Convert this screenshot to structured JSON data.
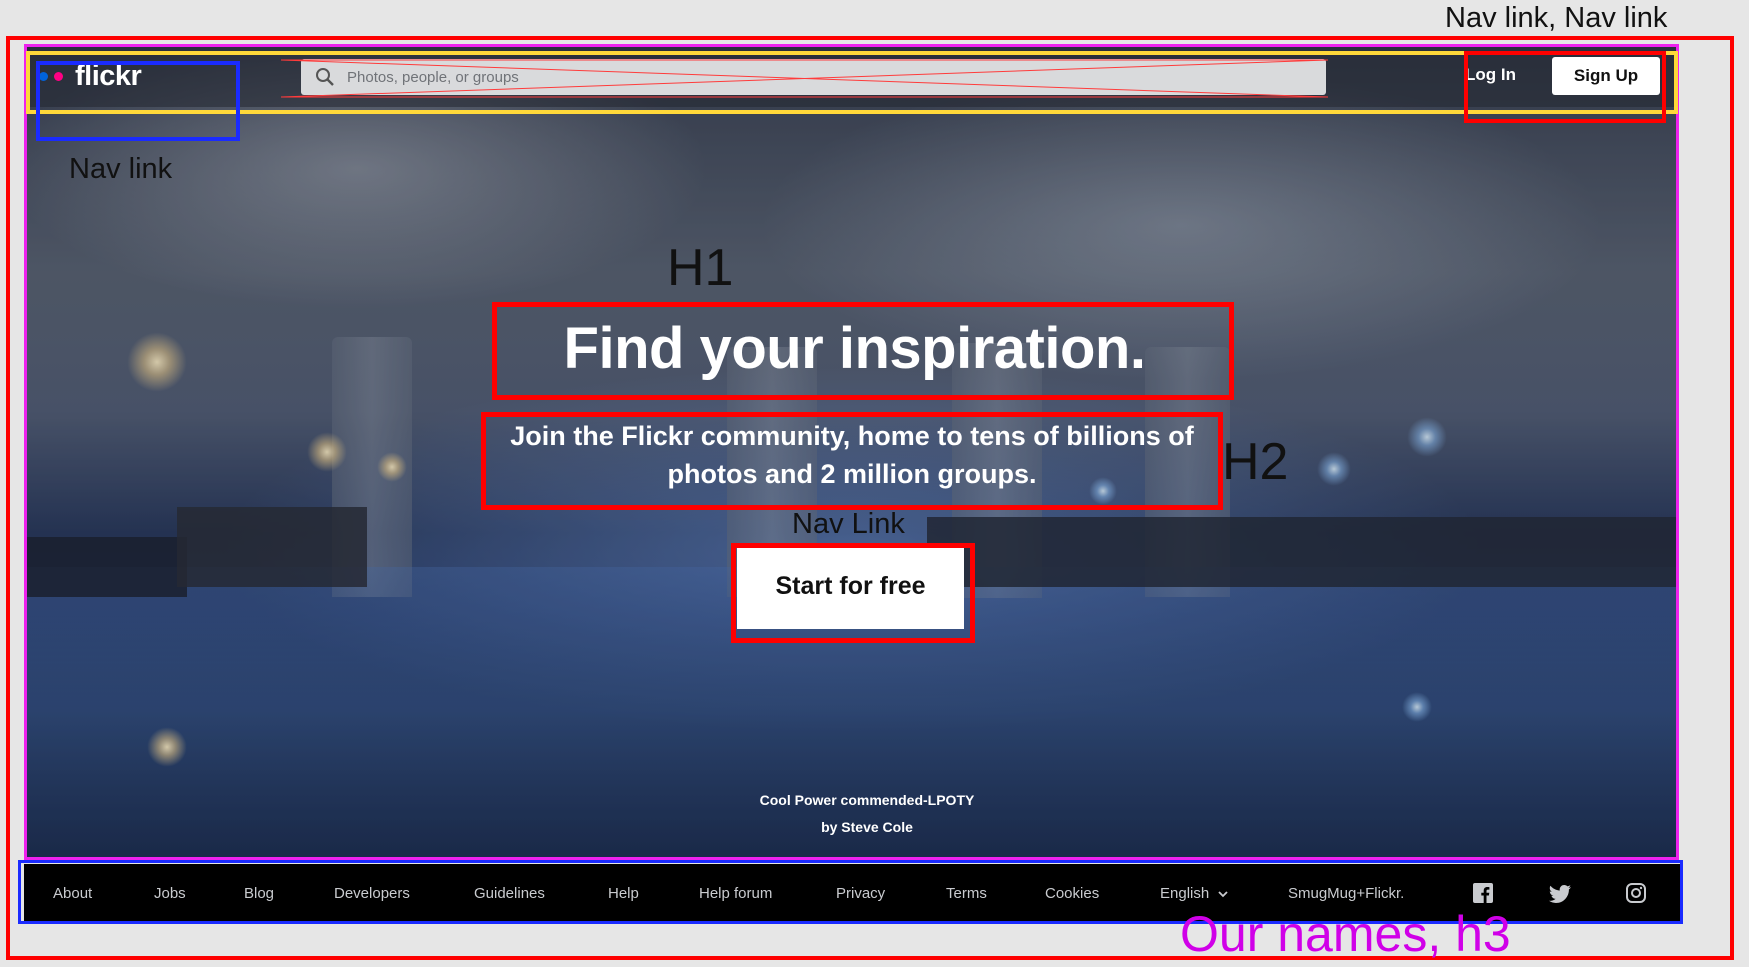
{
  "nav": {
    "logo_text": "flickr",
    "search_placeholder": "Photos, people, or groups",
    "login_label": "Log In",
    "signup_label": "Sign Up"
  },
  "hero": {
    "h1": "Find your inspiration.",
    "h2_line1": "Join the Flickr community, home to tens of billions of",
    "h2_line2": "photos and 2 million groups.",
    "cta_label": "Start for free",
    "credit_title": "Cool Power commended-LPOTY",
    "credit_author": "by Steve Cole"
  },
  "footer": {
    "links": [
      "About",
      "Jobs",
      "Blog",
      "Developers",
      "Guidelines",
      "Help",
      "Help forum",
      "Privacy",
      "Terms",
      "Cookies",
      "English",
      "SmugMug+Flickr."
    ],
    "social": [
      "facebook-icon",
      "twitter-icon",
      "instagram-icon"
    ]
  },
  "annotations": {
    "nav_link_top_right": "Nav link, Nav link",
    "nav_link_logo": "Nav link",
    "h1": "H1",
    "h2": "H2",
    "nav_link_cta": "Nav Link",
    "our_names": "Our names, h3"
  },
  "colors": {
    "annotation_red": "#ff0000",
    "annotation_blue": "#1a2bff",
    "annotation_yellow": "#ffd83a",
    "annotation_magenta": "#ee22ee",
    "flickr_blue": "#0063dc",
    "flickr_pink": "#ff0084"
  }
}
